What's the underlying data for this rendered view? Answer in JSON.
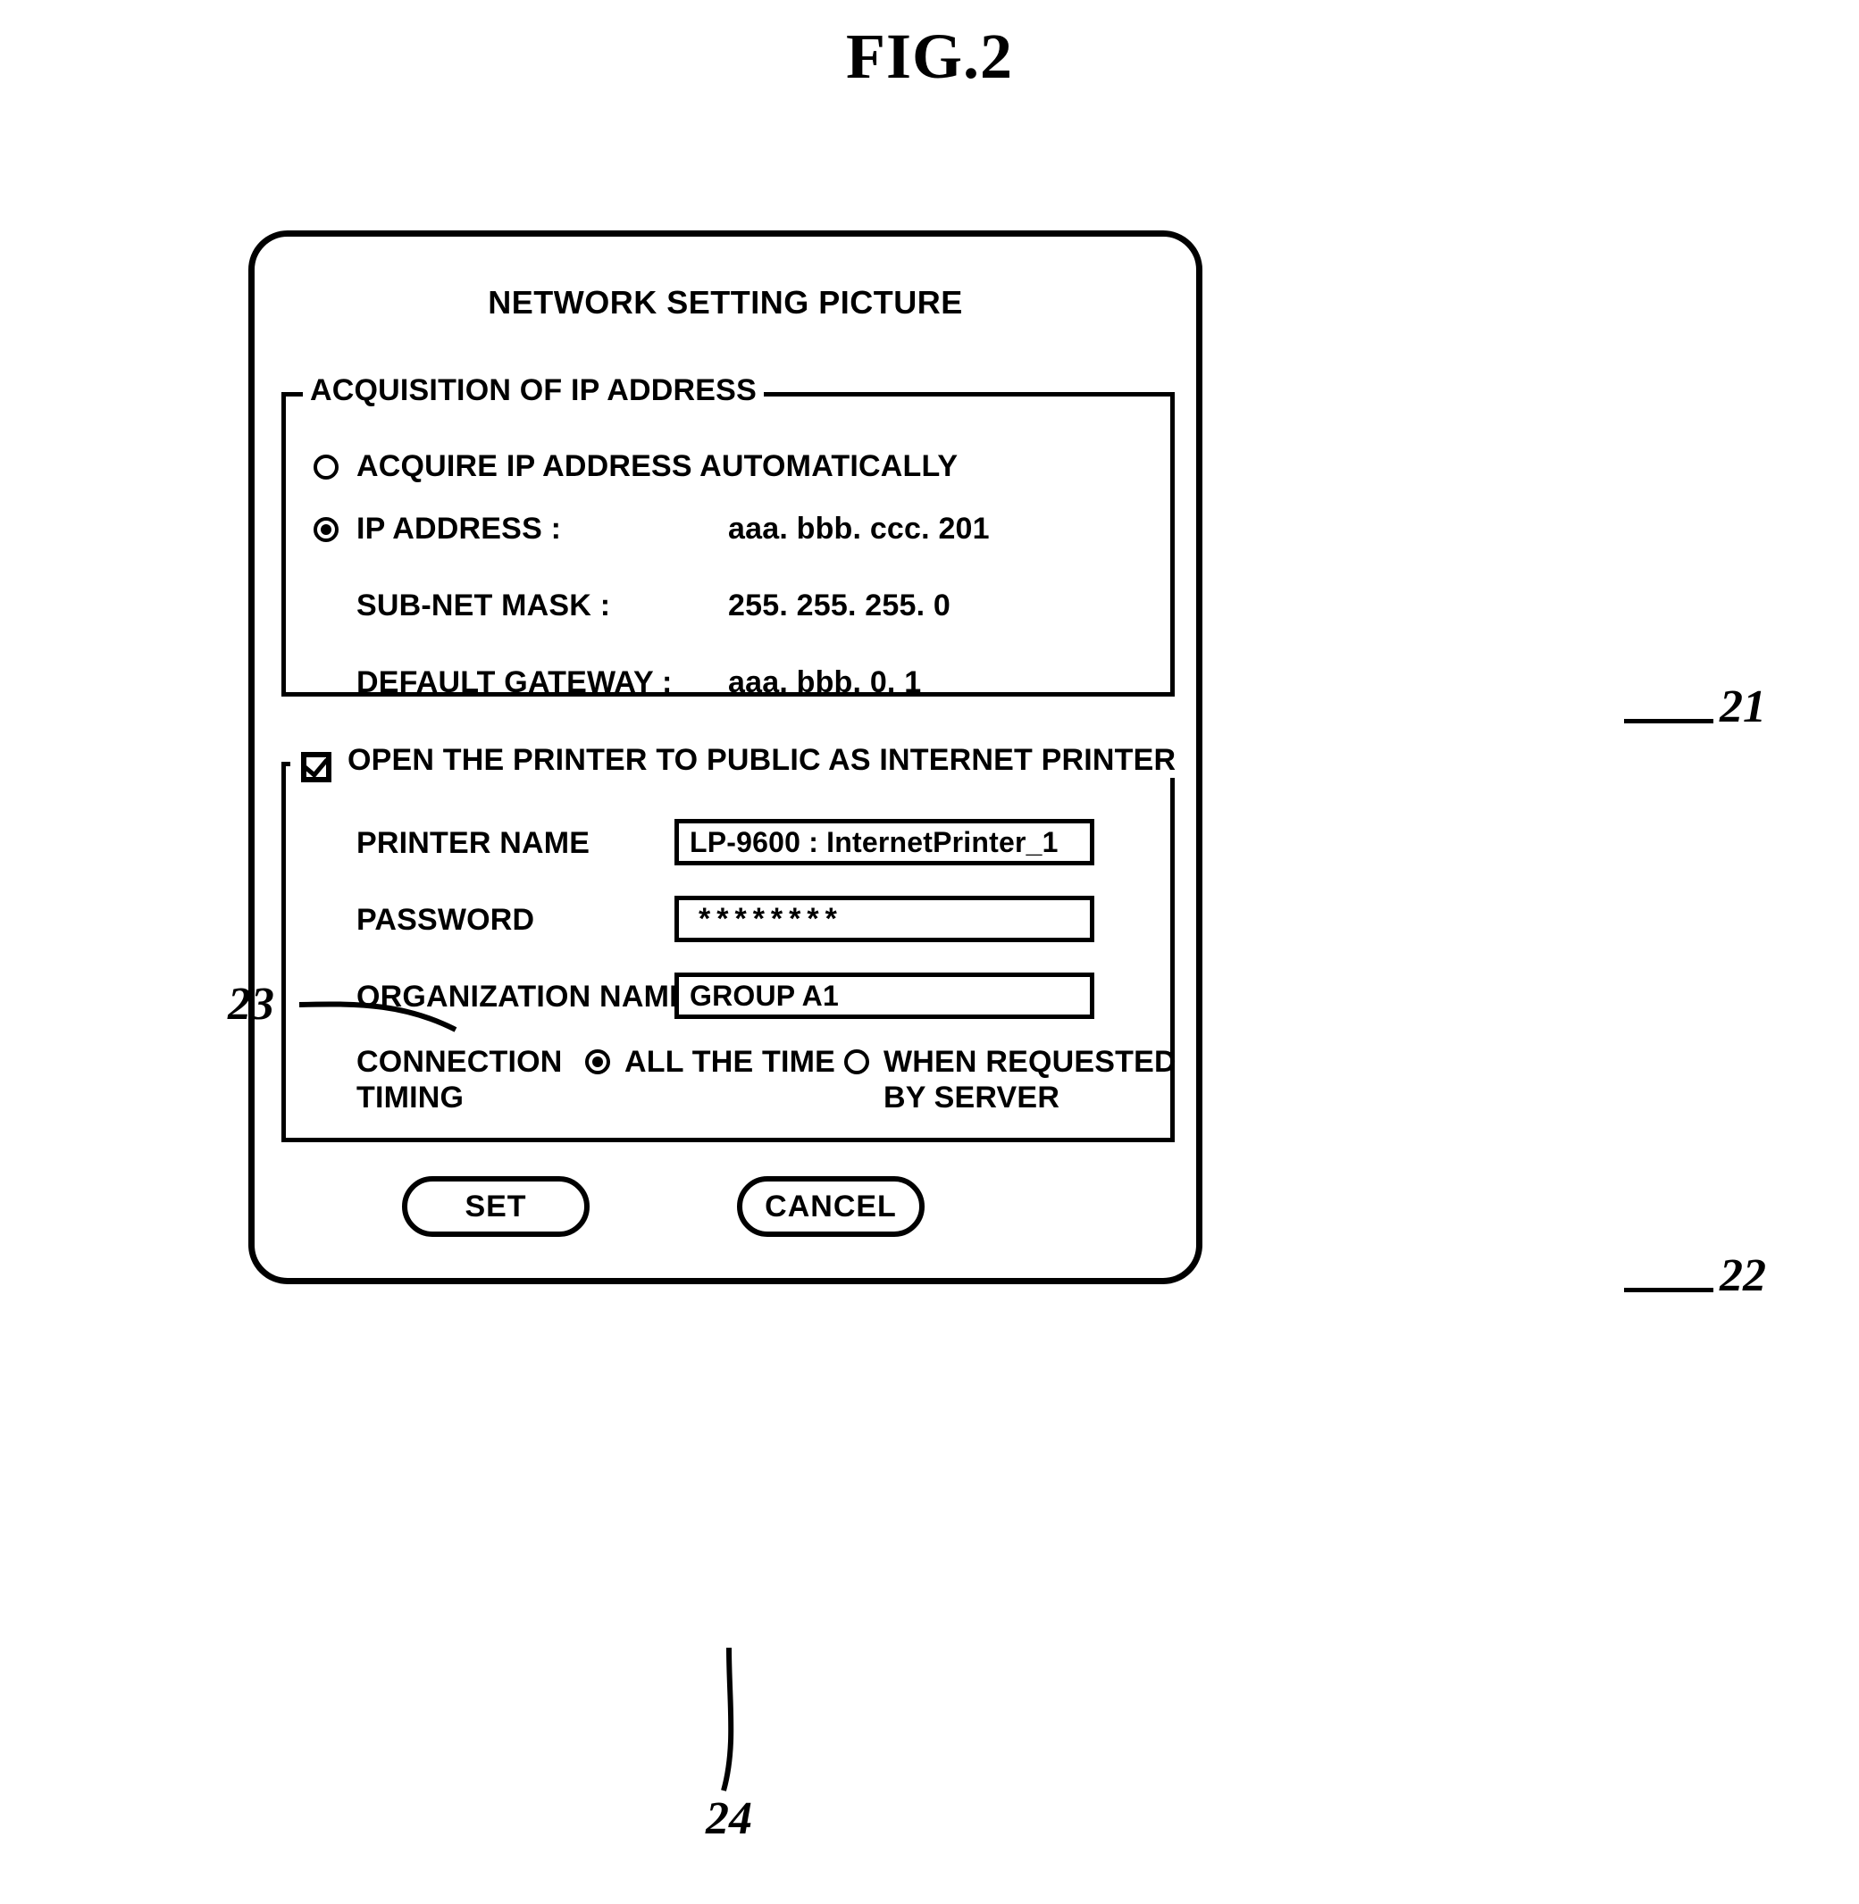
{
  "figure": {
    "title": "FIG.2"
  },
  "dialog": {
    "title": "NETWORK SETTING PICTURE",
    "ip_group": {
      "legend": "ACQUISITION OF IP ADDRESS",
      "options": [
        {
          "label": "ACQUIRE IP ADDRESS AUTOMATICALLY",
          "selected": false,
          "value": ""
        },
        {
          "label": "IP ADDRESS :",
          "selected": true,
          "value": "aaa. bbb. ccc. 201"
        }
      ],
      "fields": [
        {
          "label": "SUB-NET MASK :",
          "value": "255. 255. 255.   0"
        },
        {
          "label": "DEFAULT GATEWAY :",
          "value": "aaa. bbb.   0.   1"
        }
      ]
    },
    "printer_group": {
      "legend": "OPEN THE PRINTER TO PUBLIC AS INTERNET PRINTER",
      "checkbox_checked": true,
      "fields": [
        {
          "label": "PRINTER NAME",
          "value": "LP-9600 : InternetPrinter_1"
        },
        {
          "label": "PASSWORD",
          "value": "********"
        },
        {
          "label": "ORGANIZATION NAME",
          "value": "GROUP A1"
        }
      ],
      "connection_timing": {
        "label_line1": "CONNECTION",
        "label_line2": "TIMING",
        "options": [
          {
            "line1": "ALL THE TIME",
            "line2": "",
            "selected": true
          },
          {
            "line1": "WHEN REQUESTED",
            "line2": "BY SERVER",
            "selected": false
          }
        ]
      }
    },
    "buttons": {
      "set": "SET",
      "cancel": "CANCEL"
    }
  },
  "reference_numerals": {
    "dialog_ip_group": "21",
    "dialog_printer_group": "22",
    "dialog_checkbox": "23",
    "dialog_set_button": "24"
  }
}
